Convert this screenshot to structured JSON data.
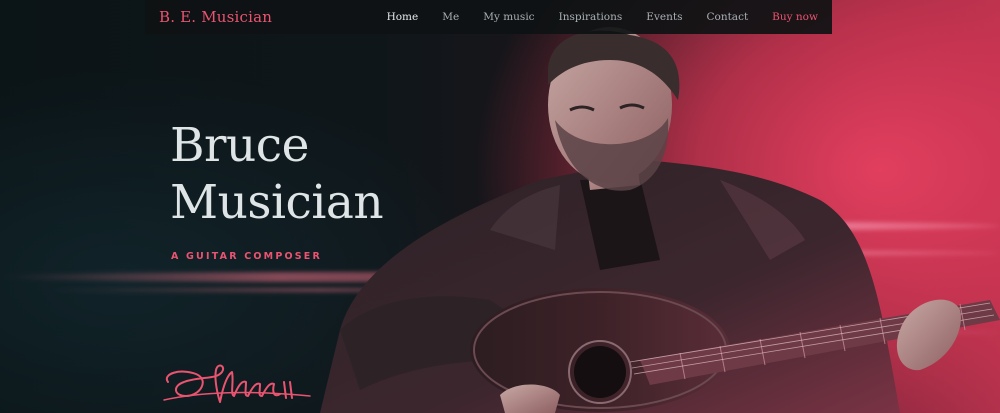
{
  "brand": {
    "name": "B. E. Musician",
    "accent_color": "#ea5470"
  },
  "nav": {
    "items": [
      {
        "label": "Home",
        "state": "active"
      },
      {
        "label": "Me"
      },
      {
        "label": "My music"
      },
      {
        "label": "Inspirations"
      },
      {
        "label": "Events"
      },
      {
        "label": "Contact"
      },
      {
        "label": "Buy now",
        "state": "highlight"
      }
    ]
  },
  "hero": {
    "title_line1": "Bruce",
    "title_line2": "Musician",
    "subtitle": "A GUITAR COMPOSER",
    "signature_icon": "signature-icon",
    "image_icon": "guitarist-photo"
  }
}
